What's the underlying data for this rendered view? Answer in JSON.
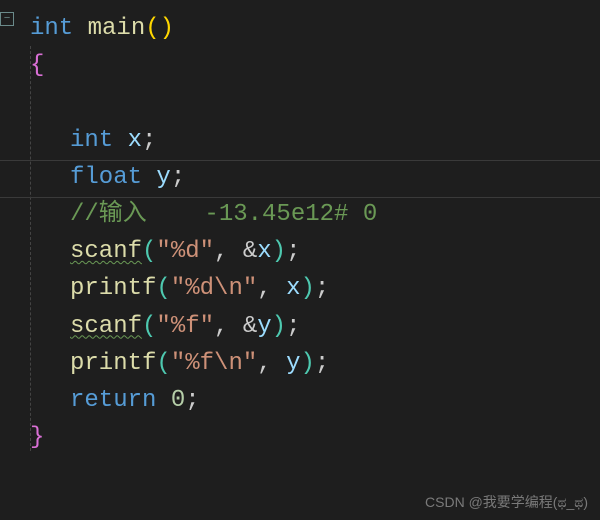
{
  "lines": {
    "l1": {
      "kw": "int",
      "sp1": " ",
      "fn": "main",
      "lp": "(",
      "rp": ")"
    },
    "l2": {
      "br": "{"
    },
    "l3": {},
    "l4": {
      "type": "int",
      "sp": " ",
      "var": "x",
      "semi": ";"
    },
    "l5": {
      "type": "float",
      "sp": " ",
      "var": "y",
      "semi": ";"
    },
    "l6": {
      "text": "//输入    -13.45e12# 0"
    },
    "l7": {
      "fn": "scanf",
      "lp": "(",
      "str": "\"%d\"",
      "comma": ", ",
      "amp": "&",
      "var": "x",
      "rp": ")",
      "semi": ";"
    },
    "l8": {
      "fn": "printf",
      "lp": "(",
      "str": "\"%d\\n\"",
      "comma": ", ",
      "var": "x",
      "rp": ")",
      "semi": ";"
    },
    "l9": {
      "fn": "scanf",
      "lp": "(",
      "str": "\"%f\"",
      "comma": ", ",
      "amp": "&",
      "var": "y",
      "rp": ")",
      "semi": ";"
    },
    "l10": {
      "fn": "printf",
      "lp": "(",
      "str": "\"%f\\n\"",
      "comma": ", ",
      "var": "y",
      "rp": ")",
      "semi": ";"
    },
    "l11": {
      "kw": "return",
      "sp": " ",
      "num": "0",
      "semi": ";"
    },
    "l12": {
      "br": "}"
    }
  },
  "watermark": "CSDN @我要学编程(ಥ_ಥ)",
  "colors": {
    "bg": "#1e1e1e",
    "keyword": "#569cd6",
    "function": "#dcdcaa",
    "variable": "#9cdcfe",
    "string": "#ce9178",
    "number": "#b5cea8",
    "comment": "#6a9955",
    "paren": "#ffd700",
    "brace": "#da70d6"
  },
  "fold_glyph": "−"
}
